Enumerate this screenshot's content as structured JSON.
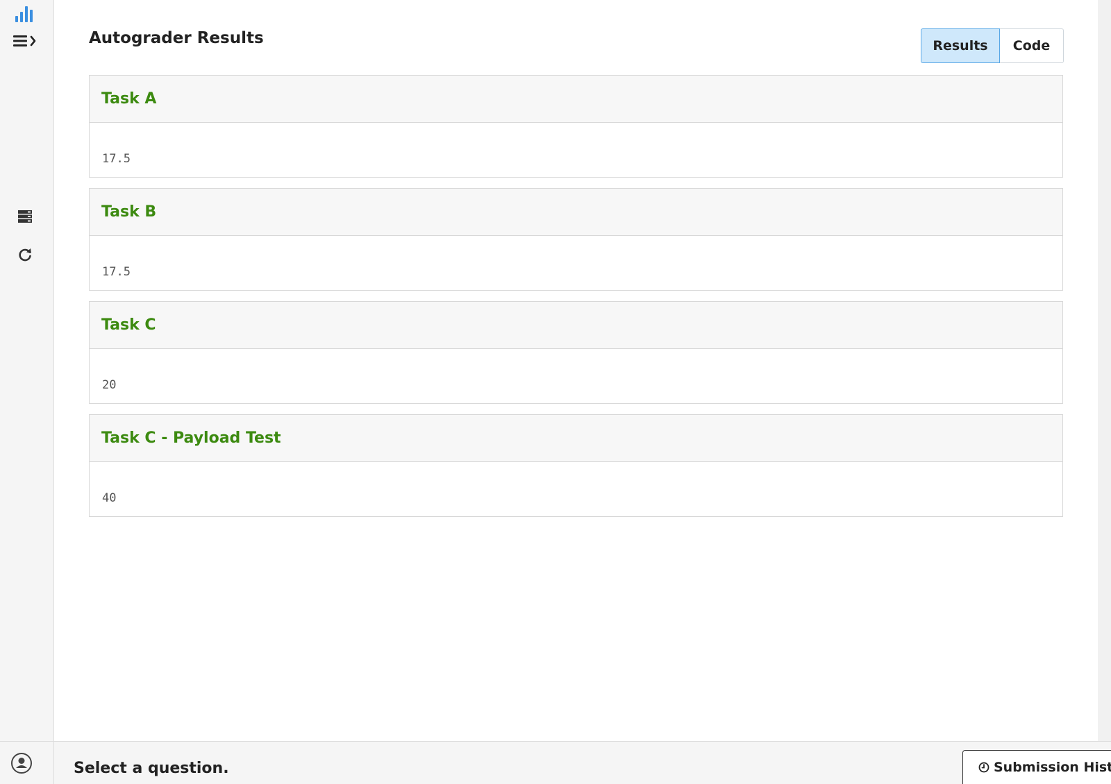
{
  "page": {
    "title": "Autograder Results"
  },
  "view_toggle": {
    "results_label": "Results",
    "code_label": "Code",
    "active": "Results"
  },
  "tests": [
    {
      "name": "Task A",
      "score": "17.5"
    },
    {
      "name": "Task B",
      "score": "17.5"
    },
    {
      "name": "Task C",
      "score": "20"
    },
    {
      "name": "Task C - Payload Test",
      "score": "40"
    }
  ],
  "sidebar": {
    "icons": [
      "bar-chart-icon",
      "menu-expand-icon",
      "server-icon",
      "refresh-icon"
    ]
  },
  "footer": {
    "message": "Select a question.",
    "submission_history_label": "Submission History"
  },
  "colors": {
    "accent": "#3b8fe0",
    "passed": "#3c8a10",
    "active_toggle": "#cfe8fb"
  }
}
